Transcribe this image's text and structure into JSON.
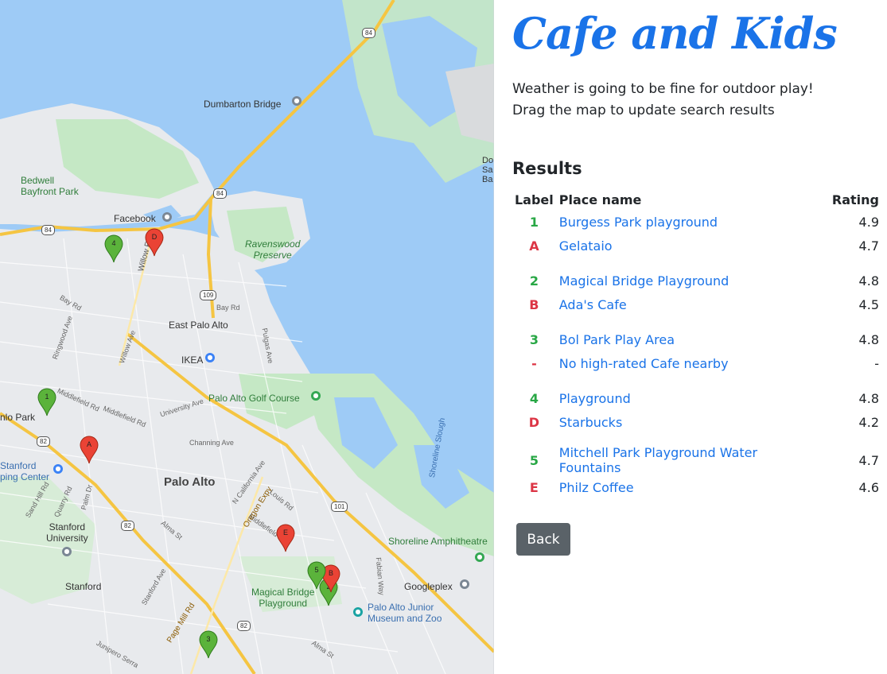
{
  "app": {
    "title": "Cafe and Kids",
    "weather_message": "Weather is going to be fine for outdoor play!",
    "drag_hint": "Drag the map to update search results",
    "results_heading": "Results",
    "back_label": "Back",
    "accent_color": "#1a73e8"
  },
  "table": {
    "headers": {
      "label": "Label",
      "name": "Place name",
      "rating": "Rating"
    },
    "groups": [
      {
        "play": {
          "label": "1",
          "name": "Burgess Park playground",
          "rating": "4.9"
        },
        "cafe": {
          "label": "A",
          "name": "Gelataio",
          "rating": "4.7"
        }
      },
      {
        "play": {
          "label": "2",
          "name": "Magical Bridge Playground",
          "rating": "4.8"
        },
        "cafe": {
          "label": "B",
          "name": "Ada's Cafe",
          "rating": "4.5"
        }
      },
      {
        "play": {
          "label": "3",
          "name": "Bol Park Play Area",
          "rating": "4.8"
        },
        "cafe": {
          "label": "-",
          "name": "No high-rated Cafe nearby",
          "rating": "-"
        }
      },
      {
        "play": {
          "label": "4",
          "name": "Playground",
          "rating": "4.8"
        },
        "cafe": {
          "label": "D",
          "name": "Starbucks",
          "rating": "4.2"
        }
      },
      {
        "play": {
          "label": "5",
          "name": "Mitchell Park Playground Water Fountains",
          "rating": "4.7"
        },
        "cafe": {
          "label": "E",
          "name": "Philz Coffee",
          "rating": "4.6"
        }
      }
    ]
  },
  "map": {
    "labels": {
      "dumbarton": "Dumbarton Bridge",
      "bedwell": "Bedwell\nBayfront Park",
      "facebook": "Facebook",
      "ravenswood": "Ravenswood\nPreserve",
      "east_palo_alto": "East Palo Alto",
      "ikea": "IKEA",
      "golf": "Palo Alto Golf Course",
      "palo_alto": "Palo Alto",
      "stanford_univ": "Stanford\nUniversity",
      "stanford": "Stanford",
      "shopping": "Stanford\nping Center",
      "menlo_park": "nlo Park",
      "magical_bridge": "Magical Bridge\nPlayground",
      "junior_museum": "Palo Alto Junior\nMuseum and Zoo",
      "googleplex": "Googleplex",
      "shoreline_amph": "Shoreline Amphitheatre",
      "shoreline_slough": "Shoreline Slough",
      "dumbarton_edge": "Do\nSa\nBa"
    },
    "roads": {
      "willow": "Willow Rd",
      "bay_rd": "Bay Rd",
      "bay_rd2": "Bay Rd",
      "university": "University Ave",
      "middlefield": "Middlefield Rd",
      "middlefield2": "Middlefield Rd",
      "middlefield3": "Middlefield Rd",
      "oregon": "Oregon Expy",
      "page_mill": "Page Mill Rd",
      "channing": "Channing Ave",
      "california": "N California Ave",
      "louis": "Louis Rd",
      "alma": "Alma St",
      "alma2": "Alma St",
      "pulgas": "Pulgas Ave",
      "ringwood": "Ringwood Ave",
      "fabian": "Fabian Way",
      "sand_hill": "Sand Hill Rd",
      "quarry": "Quarry Rd",
      "palm": "Palm Dr",
      "stanford_ave": "Stanford Ave",
      "junipero": "Junipero Serra",
      "willow_ave": "Willow Ave"
    },
    "shields": {
      "s84a": "84",
      "s84b": "84",
      "s84c": "84",
      "s109": "109",
      "s82a": "82",
      "s82b": "82",
      "s82c": "82",
      "s101": "101"
    },
    "markers": {
      "m1": "1",
      "m2": "2",
      "m3": "3",
      "m4": "4",
      "m5": "5",
      "mA": "A",
      "mB": "B",
      "mD": "D",
      "mE": "E"
    },
    "colors": {
      "water": "#9ecbf6",
      "land": "#e8eaed",
      "park": "#c5e8c5",
      "highway": "#fbd775",
      "play_marker": "#5bb33b",
      "cafe_marker": "#ea4335"
    }
  }
}
